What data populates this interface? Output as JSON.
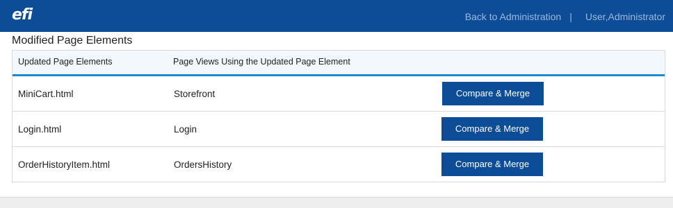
{
  "header": {
    "logo_text": "efi",
    "back_link": "Back to Administration",
    "separator": "|",
    "user": "User,Administrator",
    "bar_color": "#0d4d97"
  },
  "page": {
    "title": "Modified Page Elements"
  },
  "table": {
    "columns": [
      "Updated Page Elements",
      "Page Views Using the Updated Page Element"
    ],
    "rows": [
      {
        "element": "MiniCart.html",
        "page_view": "Storefront",
        "action": "Compare & Merge"
      },
      {
        "element": "Login.html",
        "page_view": "Login",
        "action": "Compare & Merge"
      },
      {
        "element": "OrderHistoryItem.html",
        "page_view": "OrdersHistory",
        "action": "Compare & Merge"
      }
    ],
    "header_accent_color": "#1a8ad6",
    "button_color": "#0d4d97"
  }
}
